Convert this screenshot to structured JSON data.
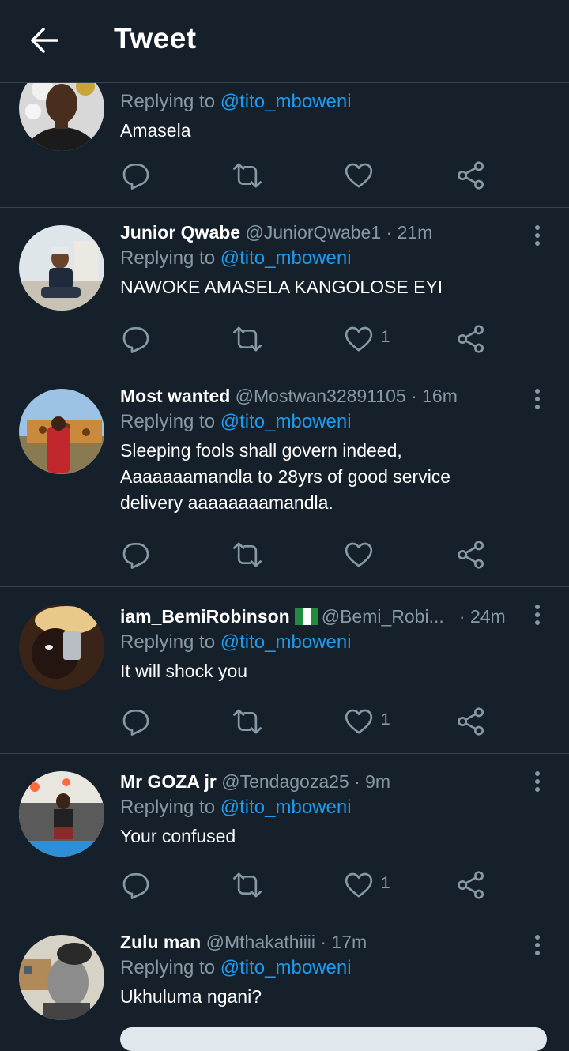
{
  "header": {
    "title": "Tweet"
  },
  "replying_prefix": "Replying to",
  "colors": {
    "background": "#15202b",
    "accent": "#1d9bf0",
    "muted": "#8899a6",
    "divider": "#38444d"
  },
  "tweets": [
    {
      "name": "",
      "handle": "",
      "time": "",
      "replying_to": "@tito_mboweni",
      "text": [
        "Amasela"
      ],
      "likes": ""
    },
    {
      "name": "Junior Qwabe",
      "handle": "@JuniorQwabe1",
      "time": "· 21m",
      "replying_to": "@tito_mboweni",
      "text": [
        "NAWOKE AMASELA KANGOLOSE EYI"
      ],
      "likes": "1"
    },
    {
      "name": "Most wanted",
      "handle": "@Mostwan32891105",
      "time": "· 16m",
      "replying_to": "@tito_mboweni",
      "text": [
        "Sleeping fools shall govern indeed,",
        "Aaaaaaamandla to 28yrs of good service",
        "delivery aaaaaaaamandla."
      ],
      "likes": ""
    },
    {
      "name": "iam_BemiRobinson",
      "handle": "@Bemi_Robi...",
      "time": "· 24m",
      "replying_to": "@tito_mboweni",
      "text": [
        "It will shock you"
      ],
      "likes": "1"
    },
    {
      "name": "Mr GOZA jr",
      "handle": "@Tendagoza25",
      "time": "· 9m",
      "replying_to": "@tito_mboweni",
      "text": [
        "Your confused"
      ],
      "likes": "1"
    },
    {
      "name": "Zulu man",
      "handle": "@Mthakathiiii",
      "time": "· 17m",
      "replying_to": "@tito_mboweni",
      "text": [
        "Ukhuluma ngani?"
      ],
      "likes": ""
    }
  ]
}
